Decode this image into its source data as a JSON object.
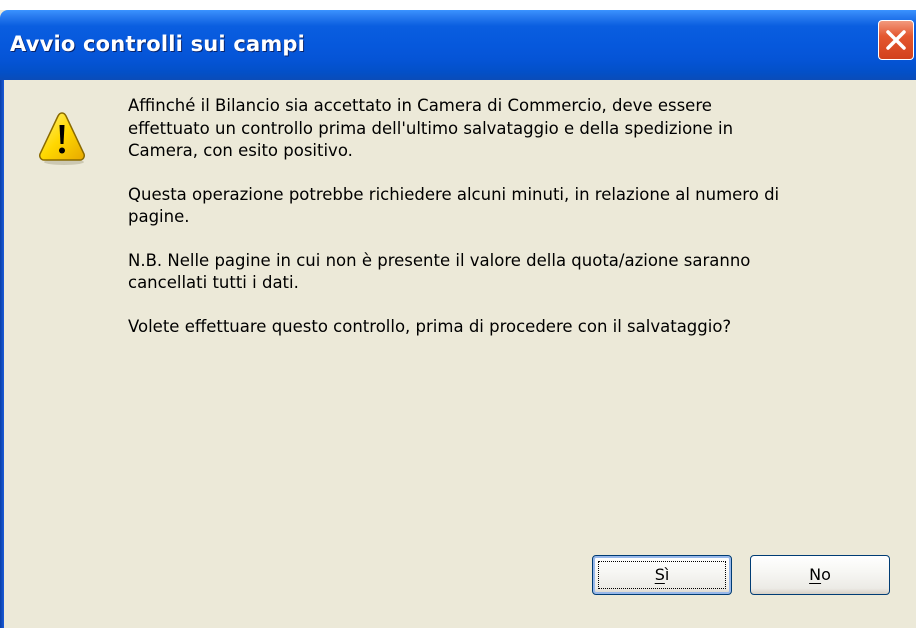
{
  "dialog": {
    "title": "Avvio controlli sui campi",
    "icon": "warning-icon",
    "paragraphs": [
      "Affinché il Bilancio sia accettato in Camera di Commercio,  deve essere\neffettuato un controllo prima dell'ultimo salvataggio e della spedizione in\nCamera, con esito positivo.",
      "Questa operazione potrebbe richiedere alcuni minuti, in relazione al numero di\npagine.",
      "N.B. Nelle pagine in cui non è presente il valore della quota/azione saranno\ncancellati tutti i dati.",
      "Volete effettuare questo controllo, prima di procedere con il salvataggio?"
    ],
    "buttons": {
      "yes_mnemonic": "S",
      "yes_rest": "ì",
      "no_mnemonic": "N",
      "no_rest": "o"
    }
  },
  "colors": {
    "titlebar": "#0658DC",
    "window_face": "#ECE9D8",
    "close": "#E4572F",
    "warning_fill": "#FFD700"
  }
}
